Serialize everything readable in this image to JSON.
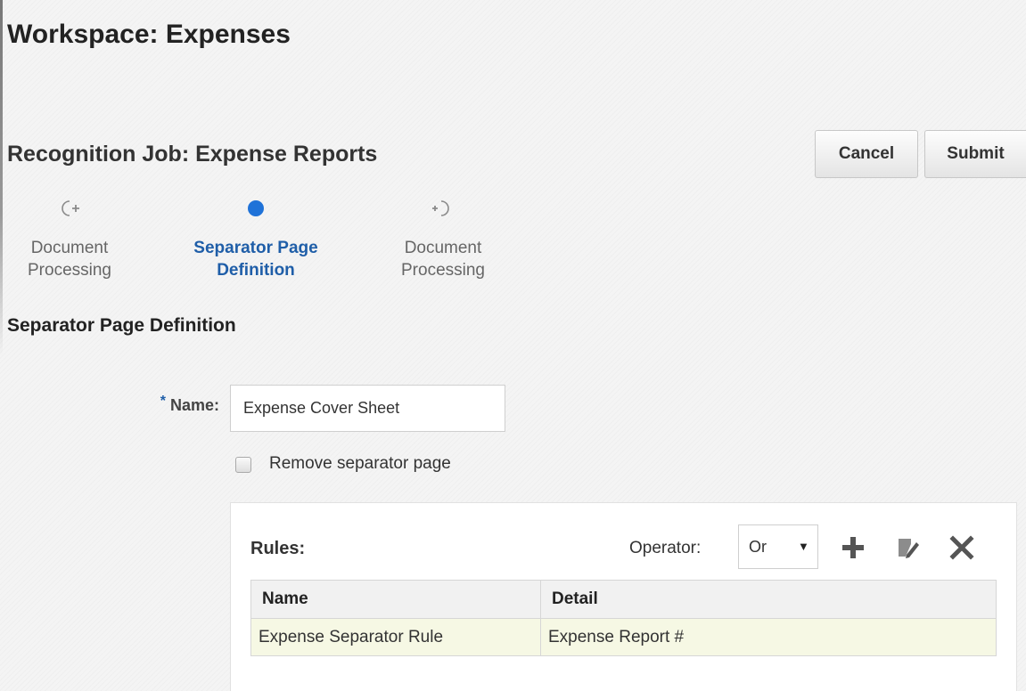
{
  "workspace": {
    "title": "Workspace: Expenses"
  },
  "job": {
    "title": "Recognition Job: Expense Reports"
  },
  "actions": {
    "cancel_label": "Cancel",
    "submit_label": "Submit"
  },
  "train": {
    "steps": [
      {
        "line1": "Document",
        "line2": "Processing",
        "state": "previous",
        "icon": "back-step-icon"
      },
      {
        "line1": "Separator Page",
        "line2": "Definition",
        "state": "current",
        "icon": "current-step-dot-icon"
      },
      {
        "line1": "Document",
        "line2": "Processing",
        "state": "next",
        "icon": "next-step-icon"
      }
    ]
  },
  "section": {
    "title": "Separator Page Definition"
  },
  "form": {
    "required_marker": "*",
    "name_label": "Name:",
    "name_value": "Expense Cover Sheet",
    "remove_separator_label": "Remove separator page",
    "remove_separator_checked": false
  },
  "rules": {
    "title": "Rules:",
    "operator_label": "Operator:",
    "operator_value": "Or",
    "toolbar_icons": [
      "add-icon",
      "edit-icon",
      "delete-icon"
    ],
    "columns": [
      "Name",
      "Detail"
    ],
    "rows": [
      {
        "name": "Expense Separator Rule",
        "detail": "Expense Report #"
      }
    ]
  },
  "colors": {
    "accent_blue": "#1f5ea8",
    "selected_row": "#f6f8e4",
    "icon_gray": "#555555"
  }
}
